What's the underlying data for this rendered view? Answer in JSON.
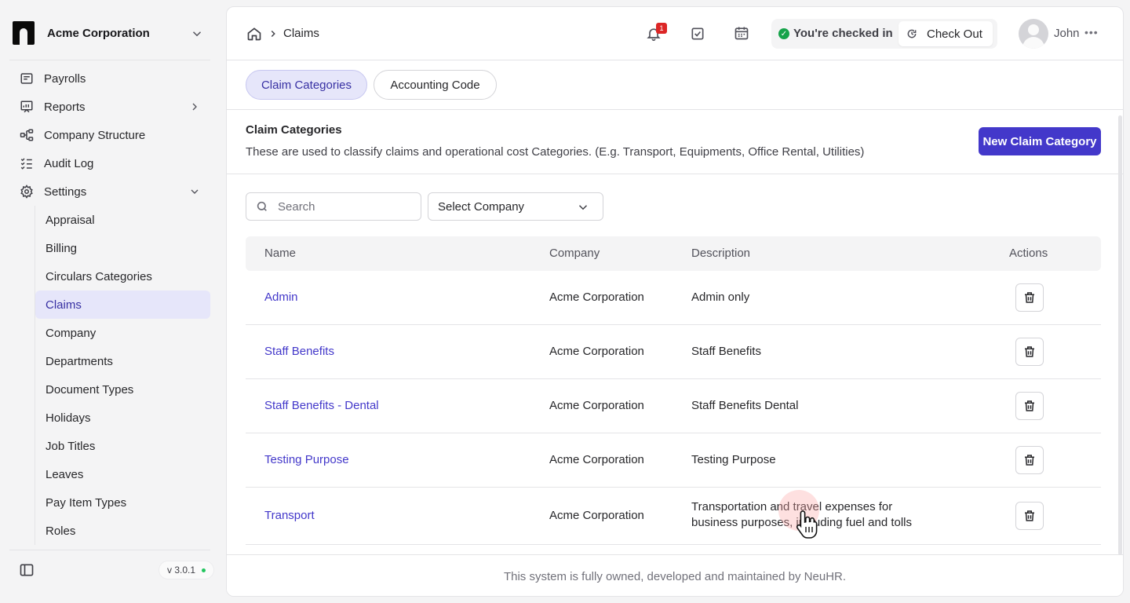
{
  "org": {
    "name": "Acme Corporation"
  },
  "sidebar": {
    "items": [
      {
        "label": "Payrolls",
        "icon": "payroll-icon"
      },
      {
        "label": "Reports",
        "icon": "reports-icon"
      },
      {
        "label": "Company Structure",
        "icon": "structure-icon"
      },
      {
        "label": "Audit Log",
        "icon": "audit-log-icon"
      },
      {
        "label": "Settings",
        "icon": "settings-gear-icon"
      }
    ],
    "settings_items": [
      "Appraisal",
      "Billing",
      "Circulars Categories",
      "Claims",
      "Company",
      "Departments",
      "Document Types",
      "Holidays",
      "Job Titles",
      "Leaves",
      "Pay Item Types",
      "Roles"
    ],
    "active_item": "Claims",
    "version": "v 3.0.1"
  },
  "header": {
    "breadcrumb": "Claims",
    "notification_count": "1",
    "checkin_status": "You're checked in",
    "checkout_label": "Check Out",
    "user_name": "John"
  },
  "tabs": [
    {
      "label": "Claim Categories",
      "active": true
    },
    {
      "label": "Accounting Code",
      "active": false
    }
  ],
  "section": {
    "title": "Claim Categories",
    "description": "These are used to classify claims and operational cost Categories. (E.g. Transport, Equipments, Office Rental, Utilities)",
    "new_button": "New Claim Category"
  },
  "filters": {
    "search_placeholder": "Search",
    "company_select": "Select Company"
  },
  "table": {
    "columns": {
      "name": "Name",
      "company": "Company",
      "description": "Description",
      "actions": "Actions"
    },
    "rows": [
      {
        "name": "Admin",
        "company": "Acme Corporation",
        "description": "Admin only"
      },
      {
        "name": "Staff Benefits",
        "company": "Acme Corporation",
        "description": "Staff Benefits"
      },
      {
        "name": "Staff Benefits - Dental",
        "company": "Acme Corporation",
        "description": "Staff Benefits Dental"
      },
      {
        "name": "Testing Purpose",
        "company": "Acme Corporation",
        "description": "Testing Purpose"
      },
      {
        "name": "Transport",
        "company": "Acme Corporation",
        "description": "Transportation and travel expenses for business purposes, including fuel and tolls"
      }
    ]
  },
  "footer": {
    "text": "This system is fully owned, developed and maintained by NeuHR."
  },
  "colors": {
    "accent": "#4338ca",
    "active_bg": "#e6e6fa",
    "success": "#16a34a",
    "badge": "#dc2626"
  }
}
